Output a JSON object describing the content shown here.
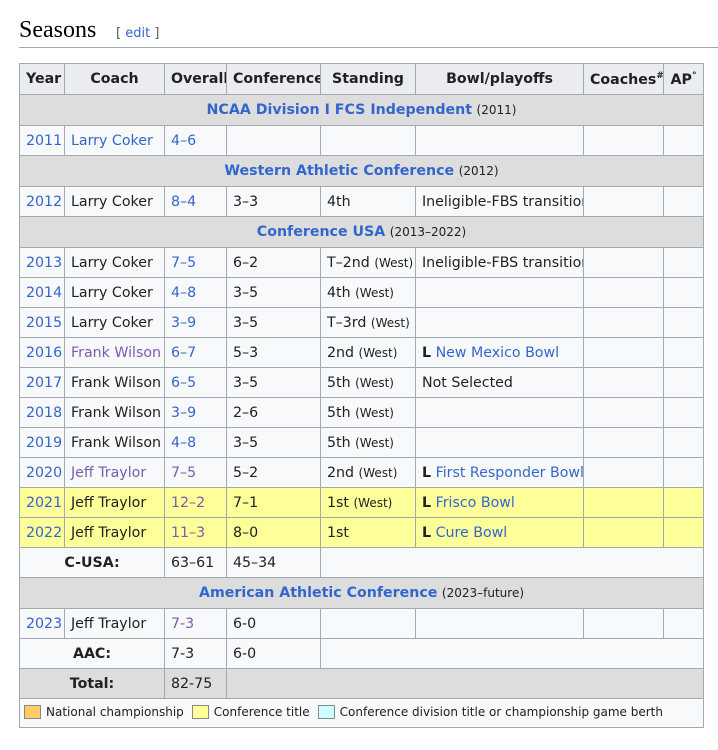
{
  "section": {
    "title": "Seasons",
    "edit_open": "[",
    "edit_label": "edit",
    "edit_close": "]"
  },
  "headers": {
    "year": "Year",
    "coach": "Coach",
    "overall": "Overall",
    "conference": "Conference",
    "standing": "Standing",
    "bowl": "Bowl/playoffs",
    "coaches": "Coaches",
    "coaches_sup": "#",
    "ap": "AP",
    "ap_sup": "°"
  },
  "groups": [
    {
      "name": "NCAA Division I FCS Independent",
      "years": "(2011)",
      "rows": [
        {
          "year": "2011",
          "coach": "Larry Coker",
          "overall": "4–6",
          "conf": "",
          "standing": "",
          "standing_small": "",
          "bowl_result": "",
          "bowl": "",
          "coach_link": true,
          "coach_visited": false,
          "overall_visited": false,
          "bowl_link": false,
          "highlight": false
        }
      ]
    },
    {
      "name": "Western Athletic Conference",
      "years": "(2012)",
      "rows": [
        {
          "year": "2012",
          "coach": "Larry Coker",
          "overall": "8–4",
          "conf": "3–3",
          "standing": "4th",
          "standing_small": "",
          "bowl_result": "",
          "bowl": "Ineligible-FBS transition",
          "coach_link": false,
          "coach_visited": false,
          "overall_visited": false,
          "bowl_link": false,
          "highlight": false
        }
      ]
    },
    {
      "name": "Conference USA",
      "years": "(2013–2022)",
      "rows": [
        {
          "year": "2013",
          "coach": "Larry Coker",
          "overall": "7–5",
          "conf": "6–2",
          "standing": "T–2nd",
          "standing_small": "(West)",
          "bowl_result": "",
          "bowl": "Ineligible-FBS transition",
          "coach_link": false,
          "coach_visited": false,
          "overall_visited": false,
          "bowl_link": false,
          "highlight": false
        },
        {
          "year": "2014",
          "coach": "Larry Coker",
          "overall": "4–8",
          "conf": "3–5",
          "standing": "4th",
          "standing_small": "(West)",
          "bowl_result": "",
          "bowl": "",
          "coach_link": false,
          "coach_visited": false,
          "overall_visited": false,
          "bowl_link": false,
          "highlight": false
        },
        {
          "year": "2015",
          "coach": "Larry Coker",
          "overall": "3–9",
          "conf": "3–5",
          "standing": "T–3rd",
          "standing_small": "(West)",
          "bowl_result": "",
          "bowl": "",
          "coach_link": false,
          "coach_visited": false,
          "overall_visited": false,
          "bowl_link": false,
          "highlight": false
        },
        {
          "year": "2016",
          "coach": "Frank Wilson",
          "overall": "6–7",
          "conf": "5–3",
          "standing": "2nd",
          "standing_small": "(West)",
          "bowl_result": "L",
          "bowl": "New Mexico Bowl",
          "coach_link": true,
          "coach_visited": true,
          "overall_visited": false,
          "bowl_link": true,
          "highlight": false
        },
        {
          "year": "2017",
          "coach": "Frank Wilson",
          "overall": "6–5",
          "conf": "3–5",
          "standing": "5th",
          "standing_small": "(West)",
          "bowl_result": "",
          "bowl": "Not Selected",
          "coach_link": false,
          "coach_visited": false,
          "overall_visited": false,
          "bowl_link": false,
          "highlight": false
        },
        {
          "year": "2018",
          "coach": "Frank Wilson",
          "overall": "3–9",
          "conf": "2–6",
          "standing": "5th",
          "standing_small": "(West)",
          "bowl_result": "",
          "bowl": "",
          "coach_link": false,
          "coach_visited": false,
          "overall_visited": false,
          "bowl_link": false,
          "highlight": false
        },
        {
          "year": "2019",
          "coach": "Frank Wilson",
          "overall": "4–8",
          "conf": "3–5",
          "standing": "5th",
          "standing_small": "(West)",
          "bowl_result": "",
          "bowl": "",
          "coach_link": false,
          "coach_visited": false,
          "overall_visited": false,
          "bowl_link": false,
          "highlight": false
        },
        {
          "year": "2020",
          "coach": "Jeff Traylor",
          "overall": "7–5",
          "conf": "5–2",
          "standing": "2nd",
          "standing_small": "(West)",
          "bowl_result": "L",
          "bowl": "First Responder Bowl",
          "coach_link": true,
          "coach_visited": true,
          "overall_visited": true,
          "bowl_link": true,
          "highlight": false
        },
        {
          "year": "2021",
          "coach": "Jeff Traylor",
          "overall": "12–2",
          "conf": "7–1",
          "standing": "1st",
          "standing_small": "(West)",
          "bowl_result": "L",
          "bowl": "Frisco Bowl",
          "coach_link": false,
          "coach_visited": false,
          "overall_visited": true,
          "bowl_link": true,
          "highlight": true
        },
        {
          "year": "2022",
          "coach": "Jeff Traylor",
          "overall": "11–3",
          "conf": "8–0",
          "standing": "1st",
          "standing_small": "",
          "bowl_result": "L",
          "bowl": "Cure Bowl",
          "coach_link": false,
          "coach_visited": false,
          "overall_visited": true,
          "bowl_link": true,
          "highlight": true
        }
      ],
      "summary": {
        "label": "C-USA:",
        "overall": "63–61",
        "conf": "45–34"
      }
    },
    {
      "name": "American Athletic Conference",
      "years": "(2023–future)",
      "rows": [
        {
          "year": "2023",
          "coach": "Jeff Traylor",
          "overall": "7-3",
          "conf": "6-0",
          "standing": "",
          "standing_small": "",
          "bowl_result": "",
          "bowl": "",
          "coach_link": false,
          "coach_visited": false,
          "overall_visited": true,
          "bowl_link": false,
          "highlight": false
        }
      ],
      "summary": {
        "label": "AAC:",
        "overall": "7-3",
        "conf": "6-0"
      }
    }
  ],
  "total": {
    "label": "Total:",
    "overall": "82-75"
  },
  "legend": [
    {
      "label": "National championship",
      "color": "#ffcc66"
    },
    {
      "label": "Conference title",
      "color": "#ffff99"
    },
    {
      "label": "Conference division title or championship game berth",
      "color": "#ccffff"
    }
  ],
  "colors": {
    "link": "#3366cc",
    "visited_link": "#795cb2",
    "row_bg": "#f8f9fa",
    "header_bg": "#eaecf0",
    "group_bg": "#dddddd",
    "border": "#a2a9b1"
  }
}
